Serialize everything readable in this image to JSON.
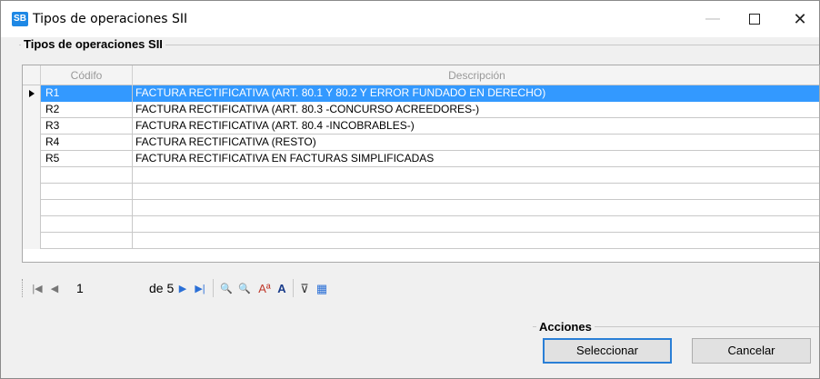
{
  "window": {
    "app_icon_text": "SB",
    "title": "Tipos de operaciones SII",
    "minimize_glyph": "—",
    "close_glyph": "✕"
  },
  "group": {
    "title": "Tipos de operaciones SII"
  },
  "grid": {
    "columns": [
      "Códifo",
      "Descripción"
    ],
    "rows": [
      {
        "code": "R1",
        "description": "FACTURA RECTIFICATIVA (ART. 80.1 Y 80.2 Y ERROR FUNDADO EN DERECHO)"
      },
      {
        "code": "R2",
        "description": "FACTURA RECTIFICATIVA (ART. 80.3 -CONCURSO ACREEDORES-)"
      },
      {
        "code": "R3",
        "description": "FACTURA RECTIFICATIVA (ART. 80.4 -INCOBRABLES-)"
      },
      {
        "code": "R4",
        "description": "FACTURA RECTIFICATIVA (RESTO)"
      },
      {
        "code": "R5",
        "description": "FACTURA RECTIFICATIVA EN FACTURAS SIMPLIFICADAS"
      },
      {
        "code": "",
        "description": ""
      },
      {
        "code": "",
        "description": ""
      },
      {
        "code": "",
        "description": ""
      },
      {
        "code": "",
        "description": ""
      },
      {
        "code": "",
        "description": ""
      }
    ],
    "selected_row": 0
  },
  "navigator": {
    "current_page": "1",
    "total_label": "de 5",
    "icons": [
      "first-icon",
      "prev-icon",
      "next-icon",
      "last-icon",
      "zoom-in-icon",
      "zoom-out-icon",
      "font-size-icon",
      "font-icon",
      "filter-icon",
      "export-icon"
    ],
    "glyphs": {
      "first": "|◀",
      "prev": "◀",
      "next": "▶",
      "last": "▶|",
      "zoom_in": "🔍",
      "zoom_out": "🔍",
      "font_size": "Aª",
      "font": "A",
      "filter": "⊽",
      "export": "▦"
    }
  },
  "actions": {
    "title": "Acciones",
    "select_label": "Seleccionar",
    "cancel_label": "Cancelar"
  },
  "colors": {
    "selection": "#3399ff",
    "accent": "#2a7fd6",
    "app_icon": "#1e88e5"
  }
}
